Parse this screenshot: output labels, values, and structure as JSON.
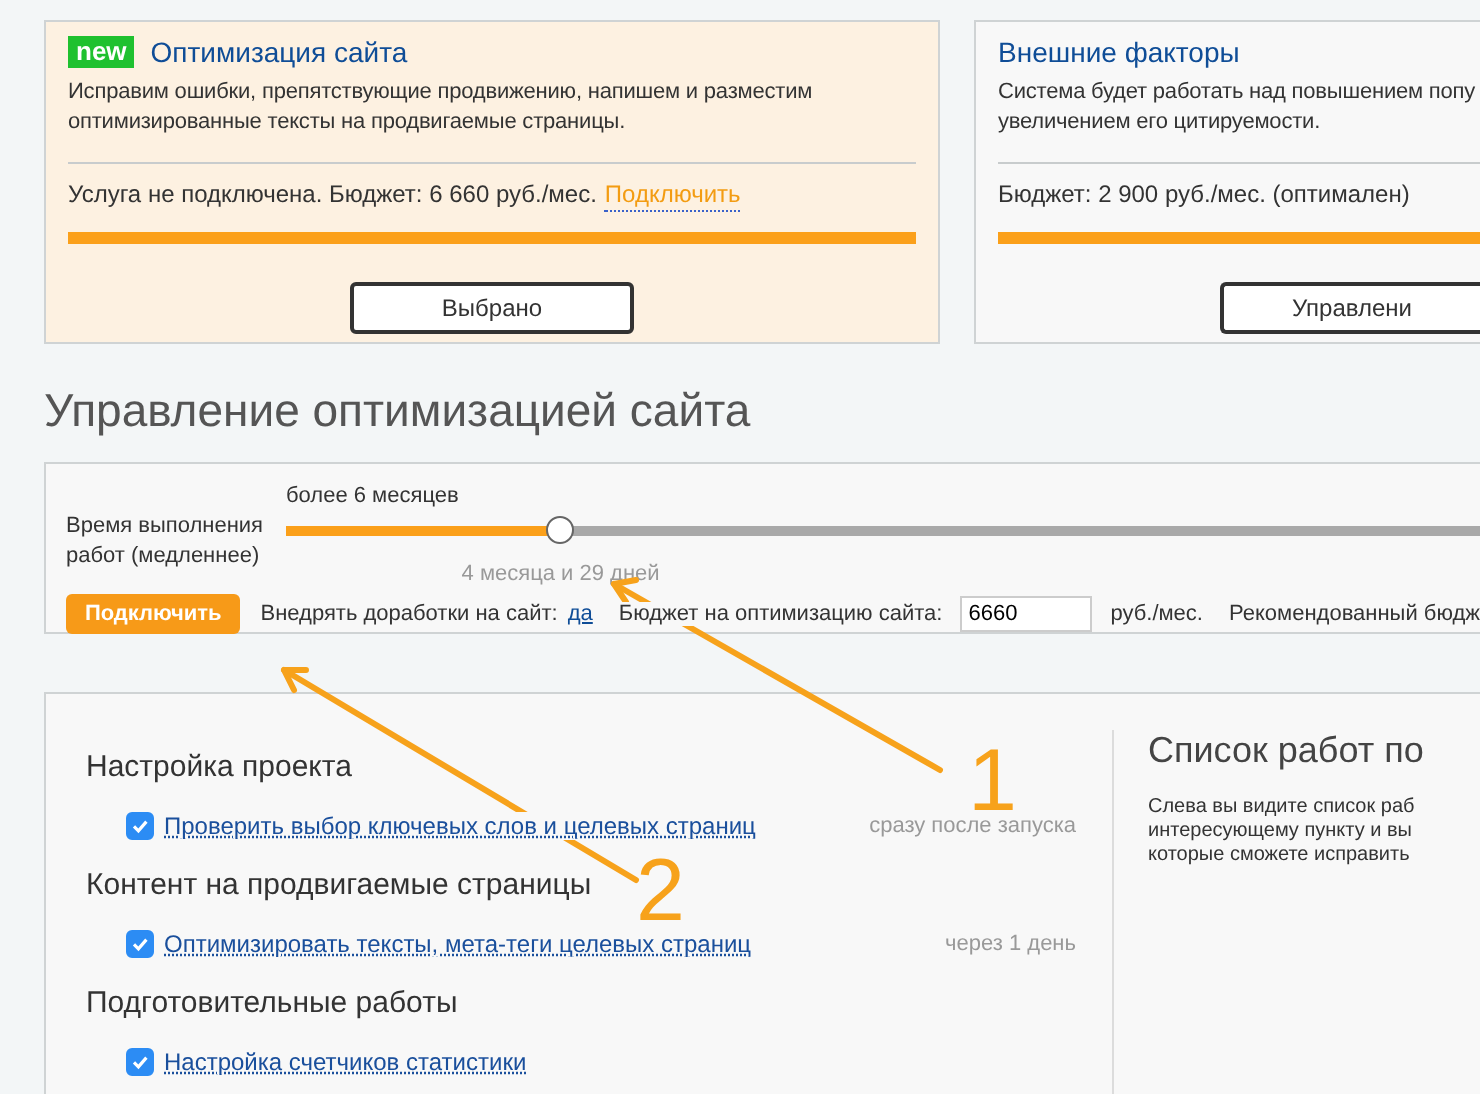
{
  "cards": [
    {
      "badge": "new",
      "title": "Оптимизация сайта",
      "description": [
        "Исправим ошибки, препятствующие продвижению, напишем и разместим",
        "оптимизированные тексты на продвигаемые страницы."
      ],
      "status": "Услуга не подключена. Бюджет: 6 660 руб./мес.",
      "link": "Подключить",
      "button": "Выбрано",
      "selected": true
    },
    {
      "title": "Внешние факторы",
      "description": [
        "Система будет работать над повышением попу",
        "увеличением его цитируемости."
      ],
      "status": "Бюджет: 2 900 руб./мес. (оптимален)",
      "button": "Управлени",
      "selected": false
    }
  ],
  "heading": "Управление оптимизацией сайта",
  "settings": {
    "slider_label": "Время выполнения работ (медленнее)",
    "top_label": "более 6 месяцев",
    "value_label": "4 месяца и 29 дней",
    "level": 0.23,
    "connect_button": "Подключить",
    "implement_label": "Внедрять доработки на сайт:",
    "implement_link": "да",
    "budget_label": "Бюджет на оптимизацию сайта:",
    "budget_value": "6660",
    "budget_unit": "руб./мес.",
    "recommended": "Рекомендованный бюдж"
  },
  "work_list": [
    {
      "title": "Настройка проекта",
      "items": [
        {
          "label": "Проверить выбор ключевых слов и целевых страниц",
          "checked": true,
          "timing": "сразу после запуска"
        }
      ]
    },
    {
      "title": "Контент на продвигаемые страницы",
      "items": [
        {
          "label": "Оптимизировать тексты, мета-теги целевых страниц",
          "checked": true,
          "timing": "через 1 день"
        }
      ]
    },
    {
      "title": "Подготовительные работы",
      "items": [
        {
          "label": "Настройка счетчиков статистики",
          "checked": true
        }
      ]
    }
  ],
  "info": {
    "title": "Список работ по",
    "lines": [
      "Слева вы видите список раб",
      "интересующему пункту и вы",
      "которые сможете исправить"
    ]
  },
  "annotations": [
    {
      "number": "1"
    },
    {
      "number": "2"
    }
  ]
}
